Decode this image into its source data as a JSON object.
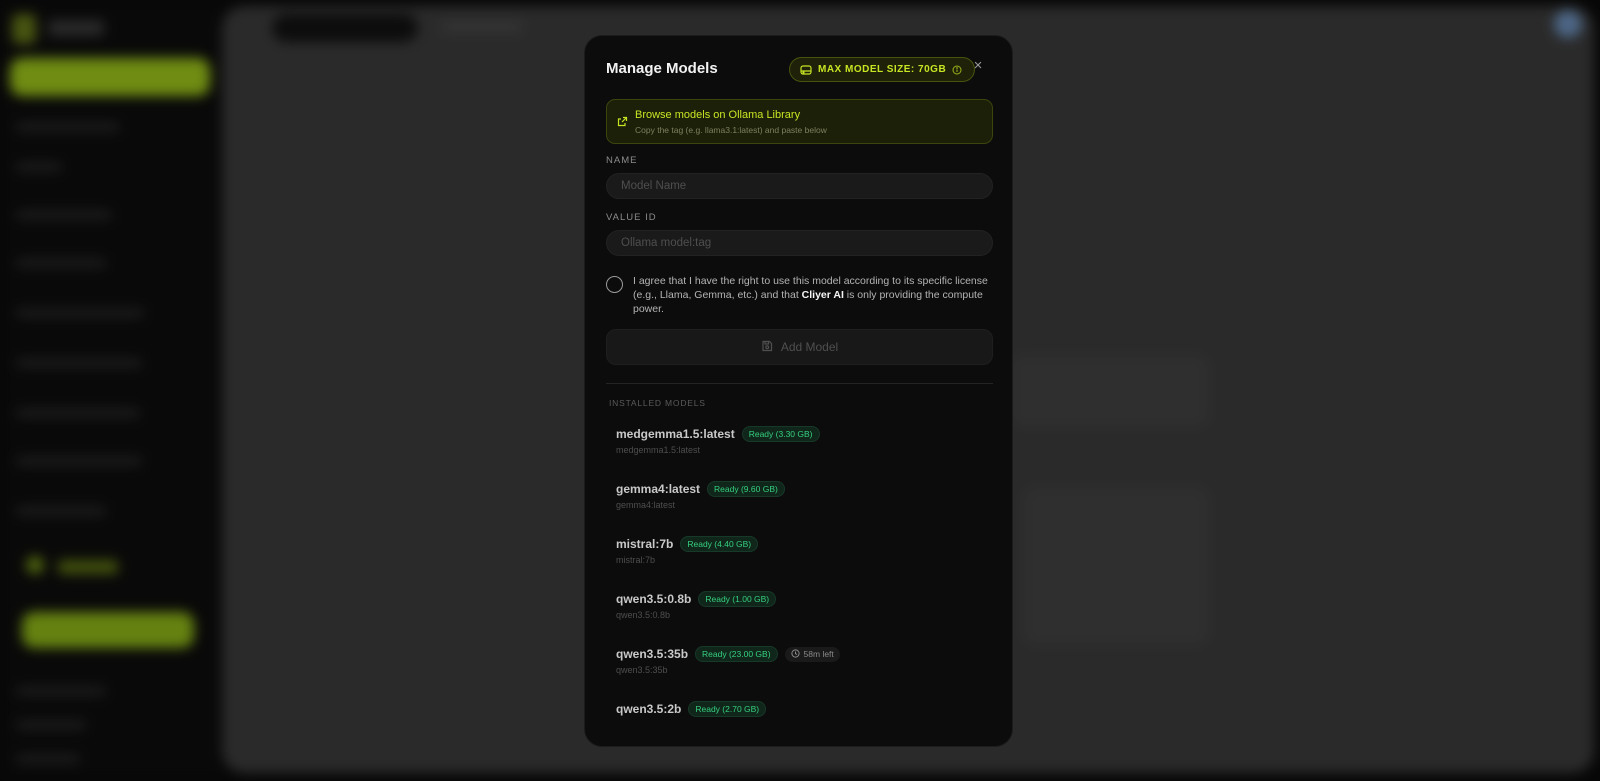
{
  "modal": {
    "title": "Manage Models",
    "max_size_label": "MAX MODEL SIZE: 70GB",
    "close_label": "×",
    "browse": {
      "link": "Browse models on Ollama Library",
      "subtitle": "Copy the tag (e.g. llama3.1:latest) and paste below"
    },
    "name_field": {
      "label": "NAME",
      "placeholder": "Model Name"
    },
    "value_field": {
      "label": "VALUE ID",
      "placeholder": "Ollama model:tag"
    },
    "agreement": {
      "before": "I agree that I have the right to use this model according to its specific license (e.g., Llama, Gemma, etc.) and that ",
      "brand": "Cliyer AI",
      "after": " is only providing the compute power."
    },
    "add_button": "Add Model",
    "installed_label": "INSTALLED MODELS",
    "models": [
      {
        "name": "medgemma1.5:latest",
        "status": "Ready (3.30 GB)",
        "tag": "medgemma1.5:latest"
      },
      {
        "name": "gemma4:latest",
        "status": "Ready (9.60 GB)",
        "tag": "gemma4:latest"
      },
      {
        "name": "mistral:7b",
        "status": "Ready (4.40 GB)",
        "tag": "mistral:7b"
      },
      {
        "name": "qwen3.5:0.8b",
        "status": "Ready (1.00 GB)",
        "tag": "qwen3.5:0.8b"
      },
      {
        "name": "qwen3.5:35b",
        "status": "Ready (23.00 GB)",
        "time_left": "58m left",
        "tag": "qwen3.5:35b"
      },
      {
        "name": "qwen3.5:2b",
        "status": "Ready (2.70 GB)",
        "tag": ""
      }
    ]
  },
  "colors": {
    "accent": "#c8e524",
    "ready": "#35d07f",
    "modal_bg": "#0c0c0c"
  },
  "icons": {
    "max_size": "hard-drive-icon",
    "info": "info-icon",
    "browse": "external-link-icon",
    "add": "save-icon",
    "time": "clock-icon"
  }
}
